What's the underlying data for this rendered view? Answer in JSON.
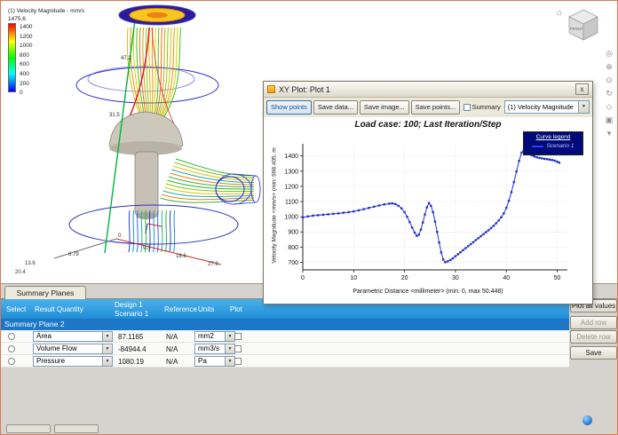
{
  "viewport": {
    "legend": {
      "title": "(1) Velocity Magnitude - mm/s",
      "max_label": "1475.6",
      "ticks": [
        "1400",
        "1200",
        "1000",
        "800",
        "600",
        "400",
        "200",
        "0"
      ]
    },
    "line_labels": {
      "upper": "47.2",
      "lower": "31.5"
    },
    "axis_ticks": {
      "origin": "0",
      "r1": "9.3",
      "r2": "18.6",
      "r3": "27.9",
      "l1": "6.79",
      "l2": "13.6",
      "l3": "20.4"
    }
  },
  "viewcube": {
    "front": "FRONT",
    "home_glyph": "⌂"
  },
  "nav_toolbar": {
    "icons": [
      {
        "name": "full-navigation-wheel-icon",
        "glyph": "◎"
      },
      {
        "name": "pan-icon",
        "glyph": "⊕"
      },
      {
        "name": "zoom-icon",
        "glyph": "⊙"
      },
      {
        "name": "orbit-icon",
        "glyph": "↻"
      },
      {
        "name": "look-at-icon",
        "glyph": "◇"
      },
      {
        "name": "viewcube-settings-icon",
        "glyph": "▣"
      },
      {
        "name": "more-options-icon",
        "glyph": "▾"
      }
    ]
  },
  "plot_window": {
    "title": "XY Plot: Plot 1",
    "close_label": "x",
    "buttons": {
      "show_points": "Show points",
      "save_data": "Save data...",
      "save_image": "Save image...",
      "save_points": "Save points..."
    },
    "summary_checkbox_label": "Summary",
    "quantity_select": "(1) Velocity Magnitude"
  },
  "chart_data": {
    "type": "line",
    "title": "Load case: 100; Last Iteration/Step",
    "xlabel": "Parametric Distance <millimeter> (min: 0, max 50.448)",
    "ylabel": "Velocity Magnitude <mm/s> (min: 698.405, m",
    "legend": {
      "title": "Curve legend",
      "entries": [
        "Scenario 1"
      ],
      "position": "top-right"
    },
    "grid": true,
    "show_points": true,
    "xlim": [
      0,
      52
    ],
    "ylim": [
      650,
      1480
    ],
    "xticks": [
      0,
      10,
      20,
      30,
      40,
      50
    ],
    "yticks": [
      700,
      800,
      900,
      1000,
      1100,
      1200,
      1300,
      1400
    ],
    "series": [
      {
        "name": "Scenario 1",
        "color": "#2230cc",
        "points": [
          [
            0,
            995
          ],
          [
            1,
            1002
          ],
          [
            2,
            1007
          ],
          [
            3,
            1010
          ],
          [
            4,
            1013
          ],
          [
            5,
            1016
          ],
          [
            6,
            1019
          ],
          [
            7,
            1022
          ],
          [
            8,
            1026
          ],
          [
            9,
            1030
          ],
          [
            10,
            1035
          ],
          [
            11,
            1042
          ],
          [
            12,
            1050
          ],
          [
            13,
            1058
          ],
          [
            14,
            1066
          ],
          [
            15,
            1074
          ],
          [
            16,
            1081
          ],
          [
            17,
            1086
          ],
          [
            17.6,
            1088
          ],
          [
            18.2,
            1083
          ],
          [
            18.8,
            1072
          ],
          [
            19.4,
            1055
          ],
          [
            20,
            1030
          ],
          [
            20.5,
            1000
          ],
          [
            21,
            965
          ],
          [
            21.5,
            928
          ],
          [
            22,
            895
          ],
          [
            22.4,
            874
          ],
          [
            22.8,
            882
          ],
          [
            23.2,
            915
          ],
          [
            23.6,
            962
          ],
          [
            24,
            1015
          ],
          [
            24.4,
            1062
          ],
          [
            24.8,
            1090
          ],
          [
            25.2,
            1072
          ],
          [
            25.6,
            1030
          ],
          [
            26,
            968
          ],
          [
            26.4,
            900
          ],
          [
            26.8,
            830
          ],
          [
            27.2,
            765
          ],
          [
            27.6,
            718
          ],
          [
            28,
            700
          ],
          [
            28.5,
            706
          ],
          [
            29,
            715
          ],
          [
            29.5,
            726
          ],
          [
            30,
            740
          ],
          [
            30.5,
            753
          ],
          [
            31,
            766
          ],
          [
            31.5,
            780
          ],
          [
            32,
            793
          ],
          [
            32.5,
            806
          ],
          [
            33,
            819
          ],
          [
            33.5,
            832
          ],
          [
            34,
            846
          ],
          [
            34.5,
            859
          ],
          [
            35,
            872
          ],
          [
            35.5,
            885
          ],
          [
            36,
            898
          ],
          [
            36.5,
            911
          ],
          [
            37,
            925
          ],
          [
            37.5,
            940
          ],
          [
            38,
            957
          ],
          [
            38.5,
            975
          ],
          [
            39,
            996
          ],
          [
            39.5,
            1022
          ],
          [
            40,
            1058
          ],
          [
            40.5,
            1105
          ],
          [
            41,
            1162
          ],
          [
            41.5,
            1228
          ],
          [
            42,
            1298
          ],
          [
            42.5,
            1368
          ],
          [
            43,
            1422
          ],
          [
            43.4,
            1436
          ],
          [
            43.8,
            1430
          ],
          [
            44.2,
            1421
          ],
          [
            44.6,
            1412
          ],
          [
            45,
            1404
          ],
          [
            45.5,
            1397
          ],
          [
            46,
            1391
          ],
          [
            46.5,
            1387
          ],
          [
            47,
            1384
          ],
          [
            47.5,
            1381
          ],
          [
            48,
            1379
          ],
          [
            48.5,
            1376
          ],
          [
            49,
            1373
          ],
          [
            49.5,
            1369
          ],
          [
            50,
            1362
          ],
          [
            50.4,
            1356
          ]
        ]
      }
    ]
  },
  "summary_panel": {
    "tab_label": "Summary Planes",
    "header": {
      "select": "Select",
      "quantity": "Result Quantity",
      "design": "Design 1",
      "scenario": "Scenario 1",
      "reference": "Reference",
      "units": "Units",
      "plot": "Plot"
    },
    "group_label": "Summary Plane 2",
    "rows": [
      {
        "quantity": "Area",
        "value": "87.1165",
        "reference": "N/A",
        "units": "mm2"
      },
      {
        "quantity": "Volume Flow",
        "value": "-84944.4",
        "reference": "N/A",
        "units": "mm3/s"
      },
      {
        "quantity": "Pressure",
        "value": "1080.19",
        "reference": "N/A",
        "units": "Pa"
      }
    ],
    "action_buttons": {
      "plot_all": "Plot all values",
      "add_row": "Add row",
      "delete_row": "Delete row",
      "save": "Save"
    }
  }
}
